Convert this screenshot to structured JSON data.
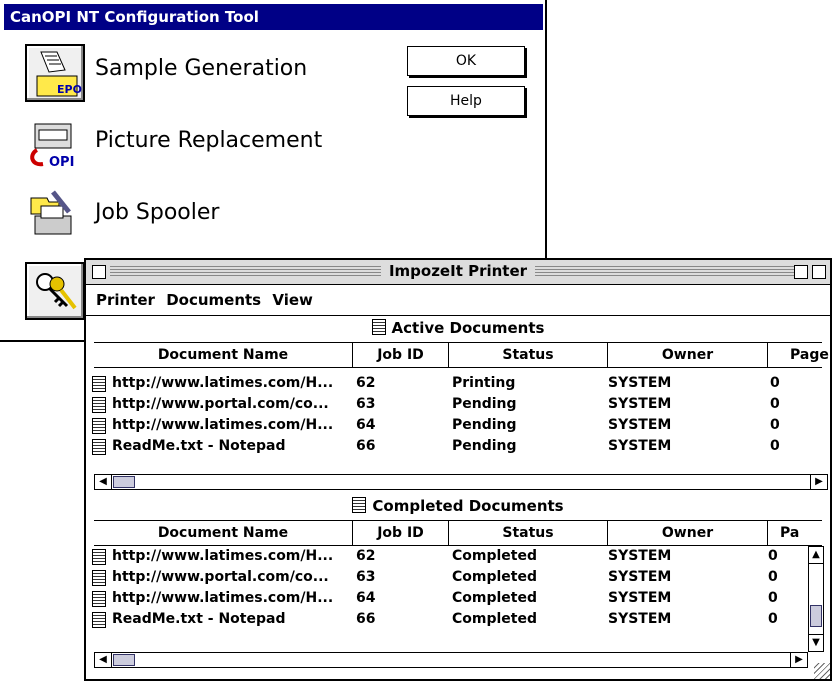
{
  "config_window": {
    "title": "CanOPI NT Configuration Tool",
    "items": [
      {
        "label": "Sample Generation",
        "icon": "sample-generation-icon"
      },
      {
        "label": "Picture Replacement",
        "icon": "picture-replacement-icon"
      },
      {
        "label": "Job Spooler",
        "icon": "job-spooler-icon"
      },
      {
        "label": "",
        "icon": "keys-icon"
      }
    ],
    "buttons": {
      "ok": "OK",
      "help": "Help"
    }
  },
  "printer_window": {
    "title": "ImpozeIt Printer",
    "menu": [
      "Printer",
      "Documents",
      "View"
    ],
    "columns": [
      "Document Name",
      "Job ID",
      "Status",
      "Owner",
      "Page"
    ],
    "completed_columns": [
      "Document Name",
      "Job ID",
      "Status",
      "Owner",
      "Pa"
    ],
    "active": {
      "title": "Active Documents",
      "rows": [
        {
          "name": "http://www.latimes.com/H...",
          "job": "62",
          "status": "Printing",
          "owner": "SYSTEM",
          "pages": "0"
        },
        {
          "name": "http://www.portal.com/co...",
          "job": "63",
          "status": "Pending",
          "owner": "SYSTEM",
          "pages": "0"
        },
        {
          "name": "http://www.latimes.com/H...",
          "job": "64",
          "status": "Pending",
          "owner": "SYSTEM",
          "pages": "0"
        },
        {
          "name": "ReadMe.txt - Notepad",
          "job": "66",
          "status": "Pending",
          "owner": "SYSTEM",
          "pages": "0"
        }
      ]
    },
    "completed": {
      "title": "Completed Documents",
      "rows": [
        {
          "name": "http://www.latimes.com/H...",
          "job": "62",
          "status": "Completed",
          "owner": "SYSTEM",
          "pages": "0"
        },
        {
          "name": "http://www.portal.com/co...",
          "job": "63",
          "status": "Completed",
          "owner": "SYSTEM",
          "pages": "0"
        },
        {
          "name": "http://www.latimes.com/H...",
          "job": "64",
          "status": "Completed",
          "owner": "SYSTEM",
          "pages": "0"
        },
        {
          "name": "ReadMe.txt - Notepad",
          "job": "66",
          "status": "Completed",
          "owner": "SYSTEM",
          "pages": "0"
        }
      ]
    }
  }
}
